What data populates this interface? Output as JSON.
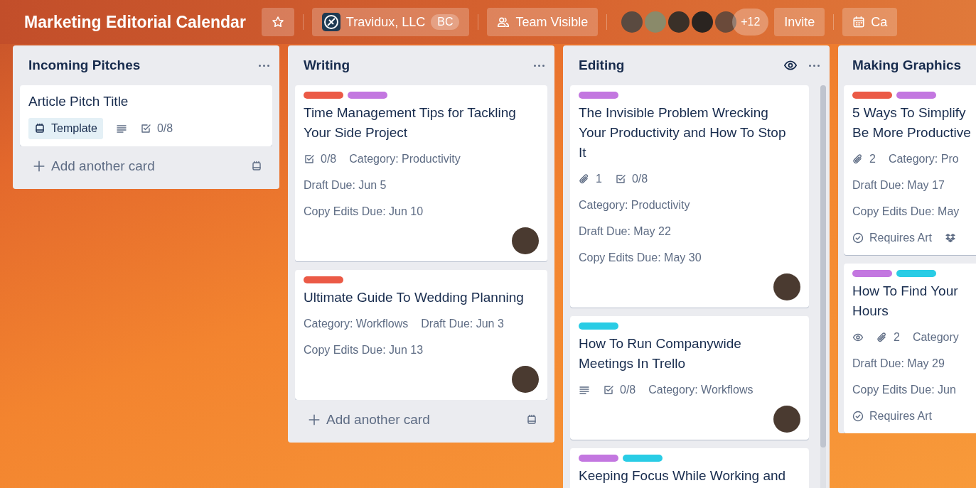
{
  "header": {
    "title": "Marketing Editorial Calendar",
    "workspace": "Travidux, LLC",
    "workspace_badge": "BC",
    "visibility": "Team Visible",
    "extra_members": "+12",
    "invite": "Invite",
    "calendar": "Ca"
  },
  "members": [
    {
      "color": "#5a4a40"
    },
    {
      "color": "#8a8a6a"
    },
    {
      "color": "#3a3028"
    },
    {
      "color": "#2a2420"
    },
    {
      "color": "#6a4a3a"
    }
  ],
  "lists": [
    {
      "title": "Incoming Pitches",
      "watched": false,
      "scroll": false,
      "add_card": "Add another card",
      "cards": [
        {
          "title_lines": [
            "Article Pitch Title"
          ],
          "member": false,
          "rows": [
            [
              {
                "kind": "template",
                "text": "Template"
              },
              {
                "kind": "description"
              },
              {
                "kind": "checklist",
                "text": "0/8"
              }
            ]
          ]
        }
      ]
    },
    {
      "title": "Writing",
      "watched": false,
      "scroll": false,
      "add_card": "Add another card",
      "cards": [
        {
          "labels": [
            {
              "color": "#eb5a46"
            },
            {
              "color": "#c377e0"
            }
          ],
          "title_lines": [
            "Time Management Tips for Tackling",
            "Your Side Project"
          ],
          "member": true,
          "rows": [
            [
              {
                "kind": "checklist",
                "text": "0/8"
              },
              {
                "kind": "text",
                "text": "Category: Productivity"
              }
            ],
            [
              {
                "kind": "text",
                "text": "Draft Due: Jun 5"
              }
            ],
            [
              {
                "kind": "text",
                "text": "Copy Edits Due: Jun 10"
              }
            ]
          ]
        },
        {
          "labels": [
            {
              "color": "#eb5a46"
            }
          ],
          "title_lines": [
            "Ultimate Guide To Wedding Planning"
          ],
          "member": true,
          "rows": [
            [
              {
                "kind": "text",
                "text": "Category: Workflows"
              },
              {
                "kind": "text",
                "text": "Draft Due: Jun 3"
              }
            ],
            [
              {
                "kind": "text",
                "text": "Copy Edits Due: Jun 13"
              }
            ]
          ]
        }
      ]
    },
    {
      "title": "Editing",
      "watched": true,
      "scroll": true,
      "cards": [
        {
          "labels": [
            {
              "color": "#c377e0"
            }
          ],
          "title_lines": [
            "The Invisible Problem Wrecking",
            "Your Productivity and How To Stop",
            "It"
          ],
          "member": true,
          "rows": [
            [
              {
                "kind": "attachment",
                "text": "1"
              },
              {
                "kind": "checklist",
                "text": "0/8"
              }
            ],
            [
              {
                "kind": "text",
                "text": "Category: Productivity"
              }
            ],
            [
              {
                "kind": "text",
                "text": "Draft Due: May 22"
              }
            ],
            [
              {
                "kind": "text",
                "text": "Copy Edits Due: May 30"
              }
            ]
          ]
        },
        {
          "labels": [
            {
              "color": "#29cce5"
            }
          ],
          "title_lines": [
            "How To Run Companywide",
            "Meetings In Trello"
          ],
          "member": true,
          "rows": [
            [
              {
                "kind": "description"
              },
              {
                "kind": "checklist",
                "text": "0/8"
              },
              {
                "kind": "text",
                "text": "Category: Workflows"
              }
            ]
          ]
        },
        {
          "labels": [
            {
              "color": "#c377e0"
            },
            {
              "color": "#29cce5"
            }
          ],
          "title_lines": [
            "Keeping Focus While Working and"
          ],
          "member": false
        }
      ]
    },
    {
      "title": "Making Graphics",
      "watched": false,
      "scroll": false,
      "cards": [
        {
          "labels": [
            {
              "color": "#eb5a46"
            },
            {
              "color": "#c377e0"
            }
          ],
          "title_lines": [
            "5 Ways To Simplify",
            "Be More Productive"
          ],
          "member": false,
          "rows": [
            [
              {
                "kind": "attachment",
                "text": "2"
              },
              {
                "kind": "text",
                "text": "Category: Pro"
              }
            ],
            [
              {
                "kind": "text",
                "text": "Draft Due: May 17"
              }
            ],
            [
              {
                "kind": "text",
                "text": "Copy Edits Due: May"
              }
            ],
            [
              {
                "kind": "done",
                "text": "Requires Art"
              },
              {
                "kind": "dropbox"
              }
            ]
          ]
        },
        {
          "labels": [
            {
              "color": "#c377e0"
            },
            {
              "color": "#29cce5"
            }
          ],
          "title_lines": [
            "How To Find Your",
            "Hours"
          ],
          "member": false,
          "rows": [
            [
              {
                "kind": "watch"
              },
              {
                "kind": "attachment",
                "text": "2"
              },
              {
                "kind": "text",
                "text": "Category"
              }
            ],
            [
              {
                "kind": "text",
                "text": "Draft Due: May 29"
              }
            ],
            [
              {
                "kind": "text",
                "text": "Copy Edits Due: Jun"
              }
            ],
            [
              {
                "kind": "done",
                "text": "Requires Art"
              }
            ]
          ]
        }
      ]
    }
  ]
}
